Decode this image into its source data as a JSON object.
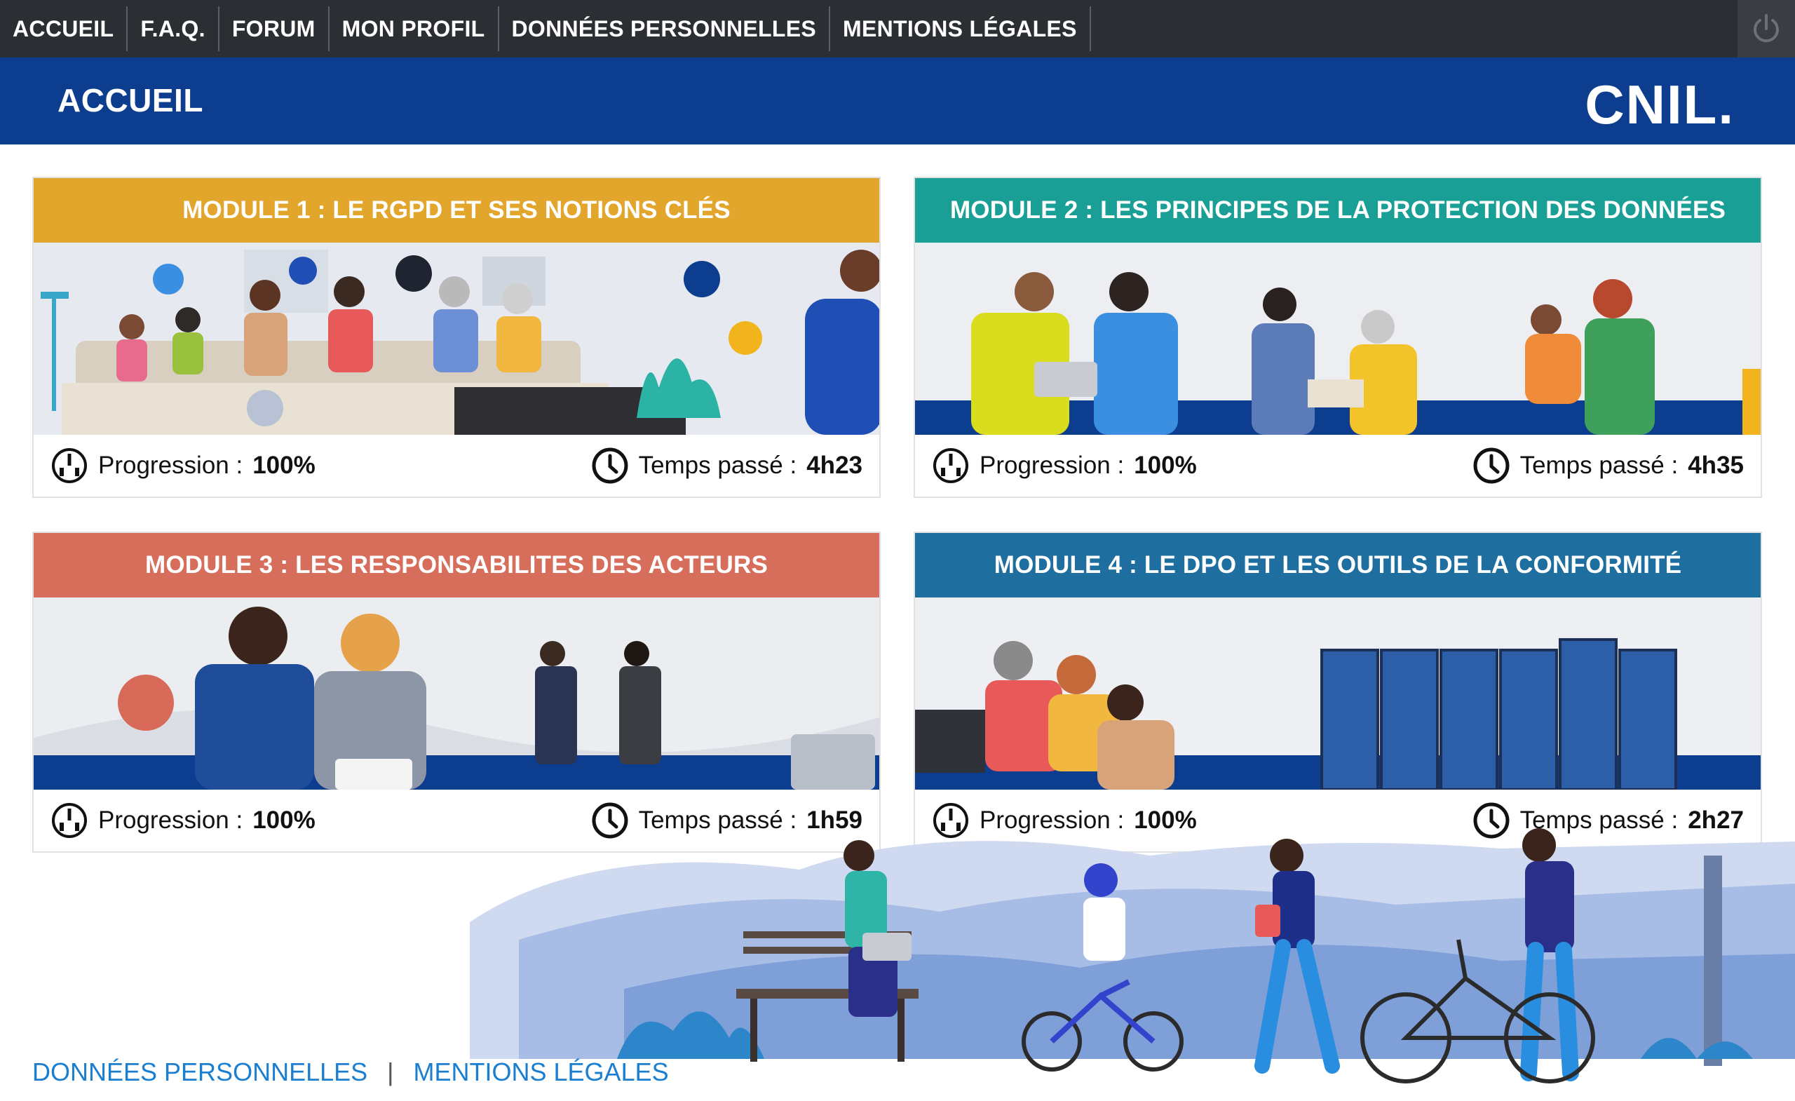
{
  "nav": {
    "items": [
      {
        "id": "accueil",
        "label": "ACCUEIL"
      },
      {
        "id": "faq",
        "label": "F.A.Q."
      },
      {
        "id": "forum",
        "label": "FORUM"
      },
      {
        "id": "profil",
        "label": "MON PROFIL"
      },
      {
        "id": "donnees",
        "label": "DONNÉES PERSONNELLES"
      },
      {
        "id": "mentions",
        "label": "MENTIONS LÉGALES"
      }
    ],
    "power_icon": "power-icon"
  },
  "header": {
    "title": "ACCUEIL",
    "logo": "CNIL."
  },
  "modules": [
    {
      "title": "MODULE 1 : LE RGPD ET SES NOTIONS CLÉS",
      "color": "#e3a62d",
      "progress_label": "Progression :",
      "progress_value": "100%",
      "time_label": "Temps passé :",
      "time_value": "4h23"
    },
    {
      "title": "MODULE 2 : LES PRINCIPES DE LA PROTECTION DES DONNÉES",
      "color": "#1a9f96",
      "progress_label": "Progression :",
      "progress_value": "100%",
      "time_label": "Temps passé :",
      "time_value": "4h35"
    },
    {
      "title": "MODULE 3 : LES RESPONSABILITES DES ACTEURS",
      "color": "#d76e5c",
      "progress_label": "Progression :",
      "progress_value": "100%",
      "time_label": "Temps passé :",
      "time_value": "1h59"
    },
    {
      "title": "MODULE 4 : LE DPO ET LES OUTILS DE LA CONFORMITÉ",
      "color": "#1e6fa0",
      "progress_label": "Progression :",
      "progress_value": "100%",
      "time_label": "Temps passé :",
      "time_value": "2h27"
    }
  ],
  "footer": {
    "link1": "DONNÉES PERSONNELLES",
    "separator": "|",
    "link2": "MENTIONS LÉGALES"
  },
  "colors": {
    "nav_bg": "#2b2e33",
    "header_bg": "#0d3d8f",
    "link": "#1a7fd1"
  }
}
